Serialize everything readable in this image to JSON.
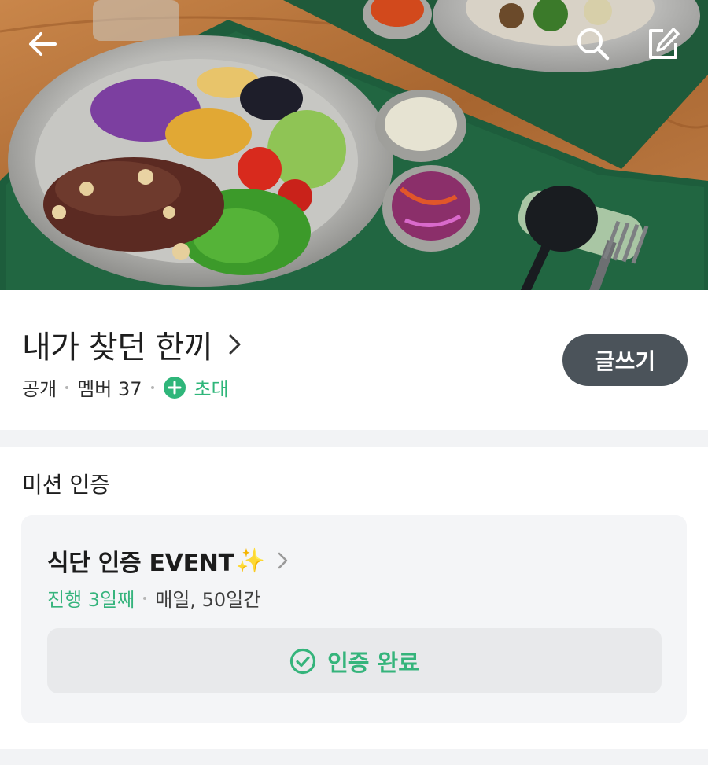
{
  "app": {
    "header": {
      "back_icon": "arrow-left-icon",
      "search_icon": "search-icon",
      "edit_icon": "edit-square-icon"
    },
    "community": {
      "title": "내가 찾던 한끼",
      "visibility": "공개",
      "members": "멤버 37",
      "invite_label": "초대",
      "write_button": "글쓰기"
    },
    "mission": {
      "section_title": "미션 인증",
      "card": {
        "title": "식단 인증 EVENT",
        "emoji": "✨",
        "progress": "진행 3일째",
        "schedule": "매일, 50일간",
        "verify_label": "인증 완료"
      }
    },
    "colors": {
      "accent_green": "#2fb67a",
      "write_button_bg": "#4b535a",
      "card_bg": "#f4f5f7"
    }
  }
}
